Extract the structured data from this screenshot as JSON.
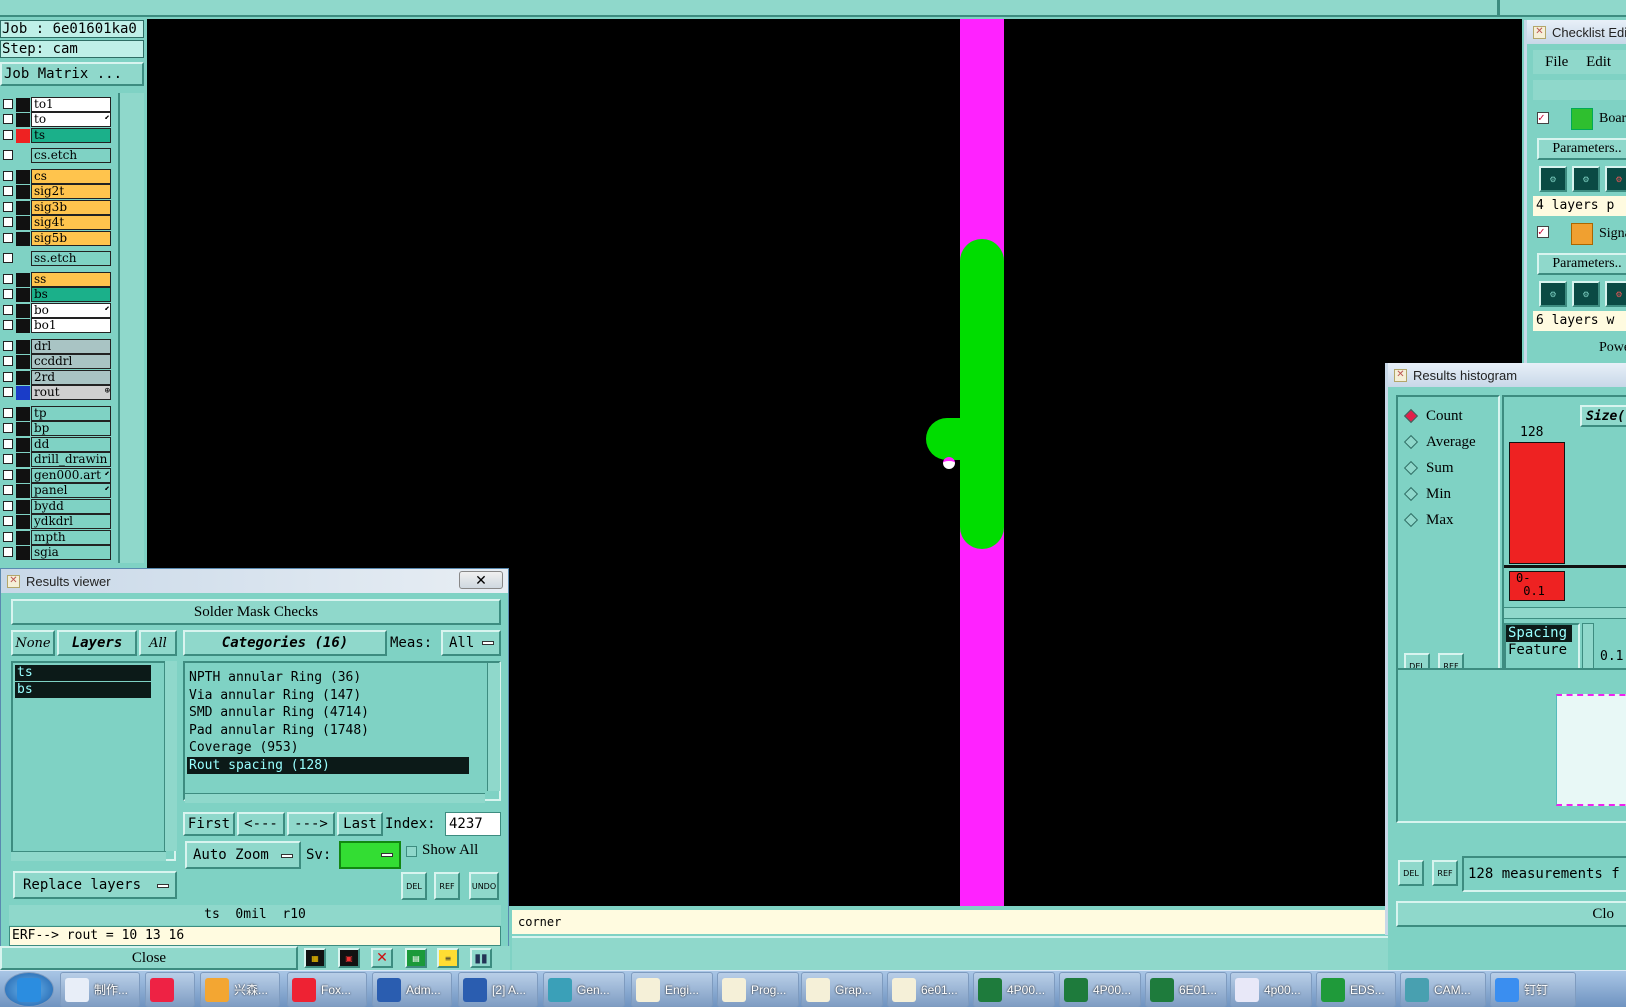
{
  "job": {
    "job_label": "Job : 6e01601ka0",
    "step_label": "Step: cam",
    "matrix_button": "Job Matrix ..."
  },
  "layers": [
    {
      "name": "to1",
      "color": "#ffffff",
      "mark": "#111111"
    },
    {
      "name": "to",
      "color": "#ffffff",
      "mark": "#111111",
      "flag": "⬋"
    },
    {
      "name": "ts",
      "color": "#1bb08a",
      "mark": "#ee2222"
    },
    {
      "name": "cs.etch",
      "color": "#7fd2c4",
      "mark": "#7fd2c4"
    },
    {
      "name": "cs",
      "color": "#ffc44d",
      "mark": "#111111"
    },
    {
      "name": "sig2t",
      "color": "#ffc44d",
      "mark": "#111111"
    },
    {
      "name": "sig3b",
      "color": "#ffc44d",
      "mark": "#111111"
    },
    {
      "name": "sig4t",
      "color": "#ffc44d",
      "mark": "#111111"
    },
    {
      "name": "sig5b",
      "color": "#ffc44d",
      "mark": "#111111"
    },
    {
      "name": "ss.etch",
      "color": "#7fd2c4",
      "mark": "#7fd2c4"
    },
    {
      "name": "ss",
      "color": "#ffc44d",
      "mark": "#111111"
    },
    {
      "name": "bs",
      "color": "#1bb08a",
      "mark": "#111111"
    },
    {
      "name": "bo",
      "color": "#ffffff",
      "mark": "#111111",
      "flag": "⬋"
    },
    {
      "name": "bo1",
      "color": "#ffffff",
      "mark": "#111111"
    },
    {
      "name": "drl",
      "color": "#a9c4c4",
      "mark": "#111111"
    },
    {
      "name": "ccddrl",
      "color": "#a9c4c4",
      "mark": "#111111"
    },
    {
      "name": "2rd",
      "color": "#a9c4c4",
      "mark": "#111111"
    },
    {
      "name": "rout",
      "color": "#d0d0d0",
      "mark": "#1a3cc8",
      "flag": "⊕"
    },
    {
      "name": "tp",
      "color": "#7fd2c4",
      "mark": "#111111"
    },
    {
      "name": "bp",
      "color": "#7fd2c4",
      "mark": "#111111"
    },
    {
      "name": "dd",
      "color": "#7fd2c4",
      "mark": "#111111"
    },
    {
      "name": "drill_drawin",
      "color": "#7fd2c4",
      "mark": "#111111"
    },
    {
      "name": "gen000.art",
      "color": "#7fd2c4",
      "mark": "#111111",
      "flag": "⬋"
    },
    {
      "name": "panel",
      "color": "#7fd2c4",
      "mark": "#111111",
      "flag": "⬋"
    },
    {
      "name": "bydd",
      "color": "#7fd2c4",
      "mark": "#111111"
    },
    {
      "name": "ydkdrl",
      "color": "#7fd2c4",
      "mark": "#111111"
    },
    {
      "name": "mpth",
      "color": "#7fd2c4",
      "mark": "#111111"
    },
    {
      "name": "sgia",
      "color": "#7fd2c4",
      "mark": "#111111"
    }
  ],
  "status_bar": {
    "text": "corner"
  },
  "results_viewer": {
    "title": "Results viewer",
    "check_name": "Solder Mask Checks",
    "none_btn": "None",
    "layers_btn": "Layers",
    "all_btn": "All",
    "categories_btn": "Categories (16)",
    "meas_label": "Meas:",
    "meas_value": "All",
    "layer_items": [
      "ts",
      "bs"
    ],
    "category_items": [
      "NPTH annular Ring (36)",
      "Via annular Ring (147)",
      "SMD annular Ring (4714)",
      "Pad annular Ring (1748)",
      "Coverage (953)",
      "Rout spacing (128)"
    ],
    "first_btn": "First",
    "prev_btn": "<---",
    "next_btn": "--->",
    "last_btn": "Last",
    "index_label": "Index:",
    "index_value": "4237",
    "auto_zoom": "Auto Zoom",
    "sv_label": "Sv:",
    "show_all": "Show All",
    "replace_layers": "Replace layers",
    "del_btn": "DEL",
    "ref_btn": "REF",
    "undo_btn": "UNDO",
    "info_line": "ts  0mil  r10",
    "erf_line": "ERF--> rout = 10 13 16",
    "close_btn": "Close"
  },
  "checklist_editor": {
    "title": "Checklist Edit",
    "menu_file": "File",
    "menu_edit": "Edit",
    "item1": "Boar",
    "params1": "Parameters..",
    "summary1": "4 layers p",
    "item2": "Signa",
    "params2": "Parameters..",
    "summary2": "6 layers w",
    "item3": "Power"
  },
  "histogram": {
    "title": "Results histogram",
    "options": [
      "Count",
      "Average",
      "Sum",
      "Min",
      "Max"
    ],
    "selected": "Count",
    "size_btn": "Size(",
    "bar_value": "128",
    "bar_label": "0-\n 0.1",
    "spacing_items": [
      "Spacing",
      "Feature"
    ],
    "scale_value": "0.1",
    "del_btn": "DEL",
    "ref_btn": "REF",
    "measurements_text": "128 measurements f",
    "close_btn": "Clo"
  },
  "taskbar": {
    "items": [
      {
        "label": "",
        "icon": "windows-start-icon"
      },
      {
        "label": "制作...",
        "icon": "notepad-icon"
      },
      {
        "label": "",
        "icon": "flower-app-icon"
      },
      {
        "label": "兴森...",
        "icon": "shell-icon"
      },
      {
        "label": "Fox...",
        "icon": "foxit-icon"
      },
      {
        "label": "Adm...",
        "icon": "floppy-icon"
      },
      {
        "label": "[2] A...",
        "icon": "floppy-icon"
      },
      {
        "label": "Gen...",
        "icon": "genesis-icon"
      },
      {
        "label": "Engi...",
        "icon": "x-window-icon"
      },
      {
        "label": "Prog...",
        "icon": "x-window-icon"
      },
      {
        "label": "Grap...",
        "icon": "x-window-icon"
      },
      {
        "label": "6e01...",
        "icon": "x-window-icon"
      },
      {
        "label": "4P00...",
        "icon": "excel-icon"
      },
      {
        "label": "4P00...",
        "icon": "excel-icon"
      },
      {
        "label": "6E01...",
        "icon": "excel-icon"
      },
      {
        "label": "4p00...",
        "icon": "doc-icon"
      },
      {
        "label": "EDS...",
        "icon": "eds-icon"
      },
      {
        "label": "CAM...",
        "icon": "cam-icon"
      },
      {
        "label": "钉钉",
        "icon": "dingtalk-icon"
      }
    ]
  },
  "colors": {
    "magenta": "#ff22ff",
    "green": "#00dd00",
    "panel": "#7fd2c4",
    "selected": "#1bb08a"
  }
}
